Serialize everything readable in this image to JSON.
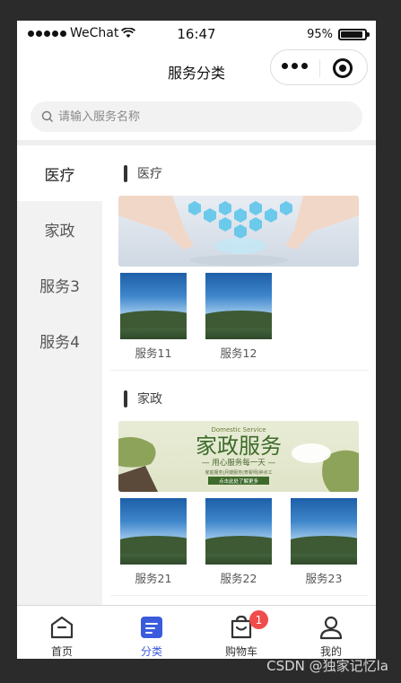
{
  "status_bar": {
    "carrier": "WeChat",
    "time": "16:47",
    "battery": "95%"
  },
  "nav": {
    "title": "服务分类"
  },
  "search": {
    "placeholder": "请输入服务名称"
  },
  "sidebar": {
    "items": [
      {
        "label": "医疗",
        "active": true
      },
      {
        "label": "家政",
        "active": false
      },
      {
        "label": "服务3",
        "active": false
      },
      {
        "label": "服务4",
        "active": false
      }
    ]
  },
  "sections": [
    {
      "title": "医疗",
      "banner_icon": "medical-touchscreen-banner",
      "services": [
        {
          "label": "服务11"
        },
        {
          "label": "服务12"
        }
      ]
    },
    {
      "title": "家政",
      "banner_icon": "housekeeping-banner",
      "banner_text": {
        "top": "Domestic Service",
        "main": "家政服务",
        "sub": "— 用心服务每一天 —",
        "detail": "家庭服务|月嫂服务|育婴师|钟点工",
        "button": "点击此处了解更多"
      },
      "services": [
        {
          "label": "服务21"
        },
        {
          "label": "服务22"
        },
        {
          "label": "服务23"
        }
      ]
    }
  ],
  "tabbar": {
    "items": [
      {
        "label": "首页",
        "icon": "home-icon"
      },
      {
        "label": "分类",
        "icon": "category-icon"
      },
      {
        "label": "购物车",
        "icon": "cart-icon",
        "badge": "1"
      },
      {
        "label": "我的",
        "icon": "user-icon"
      }
    ]
  },
  "colors": {
    "accent": "#3a5bdc",
    "badge": "#f14c4c",
    "sidebar_bg": "#f2f2f2"
  },
  "watermark": "CSDN @独家记忆la"
}
